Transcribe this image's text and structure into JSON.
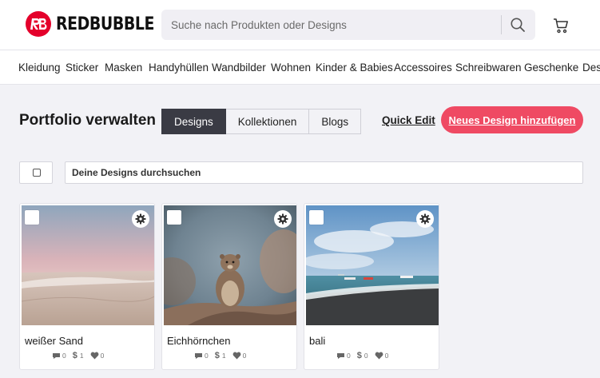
{
  "brand": {
    "name": "REDBUBBLE",
    "color": "#e4002b"
  },
  "search": {
    "placeholder": "Suche nach Produkten oder Designs"
  },
  "categories": [
    "Kleidung",
    "Sticker",
    "Masken",
    "Handyhüllen",
    "Wandbilder",
    "Wohnen",
    "Kinder & Babies",
    "Accessoires",
    "Schreibwaren",
    "Geschenke",
    "Desi"
  ],
  "page": {
    "title": "Portfolio verwalten",
    "tabs": [
      "Designs",
      "Kollektionen",
      "Blogs"
    ],
    "active_tab": "Designs",
    "quick_edit": "Quick Edit",
    "new_design": "Neues Design hinzufügen",
    "accent": "#ef4a63"
  },
  "filter": {
    "search_placeholder": "Deine Designs durchsuchen"
  },
  "designs": [
    {
      "name": "weißer Sand",
      "comments": "0",
      "sales": "1",
      "favorites": "0"
    },
    {
      "name": "Eichhörnchen",
      "comments": "0",
      "sales": "1",
      "favorites": "0"
    },
    {
      "name": "bali",
      "comments": "0",
      "sales": "0",
      "favorites": "0"
    }
  ]
}
